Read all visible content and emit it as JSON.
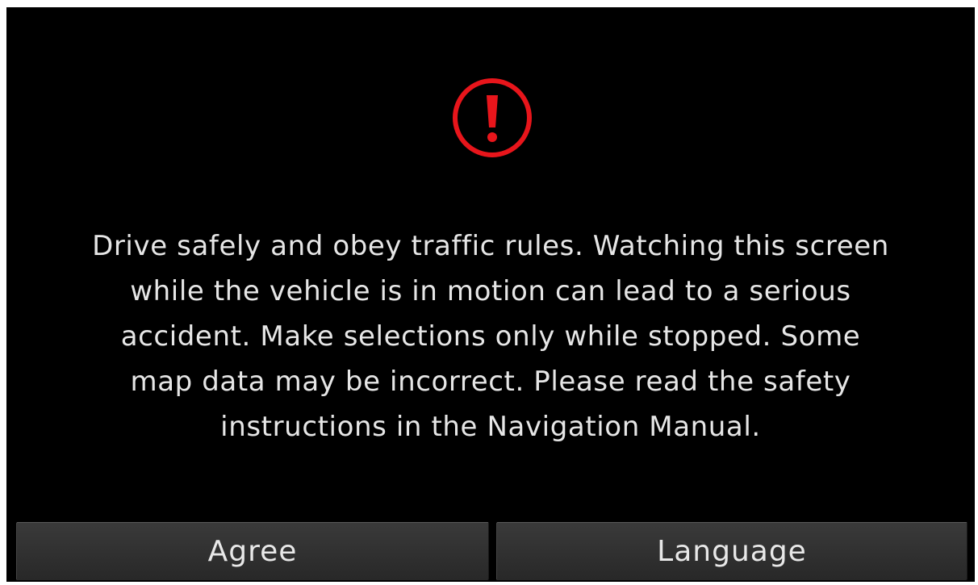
{
  "warning": {
    "icon": "exclamation-icon",
    "color": "#e8151b",
    "message": "Drive safely and obey traffic rules. Watching this screen\nwhile the vehicle is in motion can lead to a serious\naccident. Make selections only while stopped. Some\nmap data may be incorrect. Please read the safety\ninstructions in the Navigation Manual."
  },
  "buttons": {
    "agree_label": "Agree",
    "language_label": "Language"
  }
}
